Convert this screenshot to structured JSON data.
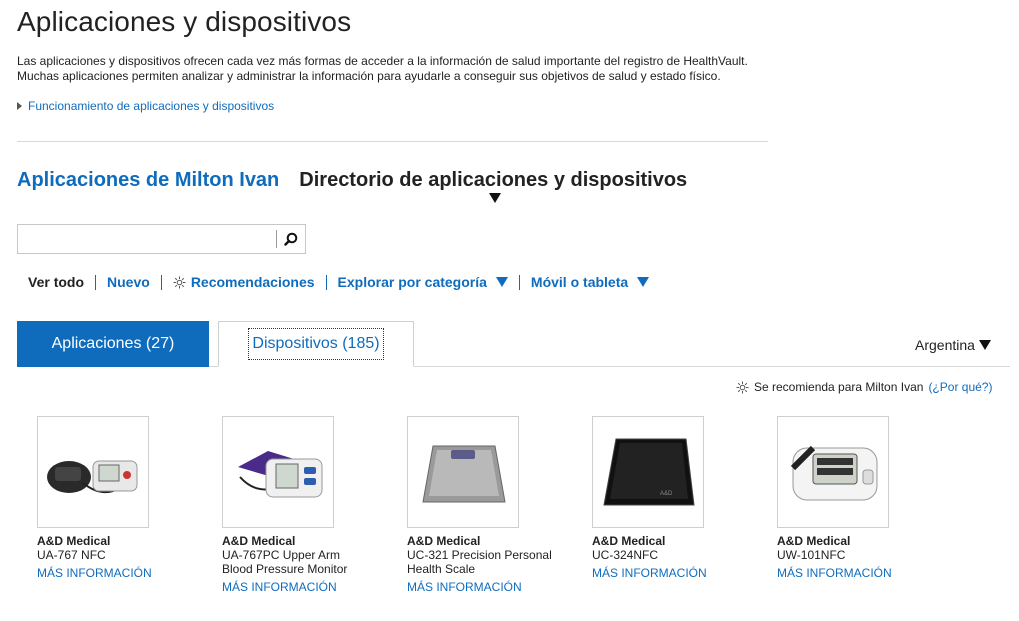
{
  "page": {
    "title": "Aplicaciones y dispositivos",
    "intro_line1": "Las aplicaciones y dispositivos ofrecen cada vez más formas de acceder a la información de salud importante del registro de HealthVault.",
    "intro_line2": "Muchas aplicaciones permiten analizar y administrar la información para ayudarle a conseguir sus objetivos de salud y estado físico.",
    "howto_link": "Funcionamiento de aplicaciones y dispositivos"
  },
  "section_tabs": {
    "my_apps": "Aplicaciones de Milton Ivan",
    "directory": "Directorio de aplicaciones y dispositivos"
  },
  "search": {
    "value": "",
    "placeholder": ""
  },
  "filters": {
    "all": "Ver todo",
    "new": "Nuevo",
    "recommended": "Recomendaciones",
    "browse": "Explorar por categoría",
    "mobile": "Móvil o tableta"
  },
  "tabs": {
    "apps": "Aplicaciones (27)",
    "devices": "Dispositivos (185)"
  },
  "country": "Argentina",
  "recommendation": {
    "text": "Se recomienda para Milton Ivan",
    "why": "(¿Por qué?)"
  },
  "devices": [
    {
      "maker": "A&D Medical",
      "model": "UA-767 NFC",
      "more": "MÁS INFORMACIÓN",
      "icon": "blood-pressure-monitors-image"
    },
    {
      "maker": "A&D Medical",
      "model": "UA-767PC Upper Arm Blood Pressure Monitor",
      "more": "MÁS INFORMACIÓN",
      "icon": "upper-arm-monitor-image"
    },
    {
      "maker": "A&D Medical",
      "model": "UC-321 Precision Personal Health Scale",
      "more": "MÁS INFORMACIÓN",
      "icon": "silver-scale-image"
    },
    {
      "maker": "A&D Medical",
      "model": "UC-324NFC",
      "more": "MÁS INFORMACIÓN",
      "icon": "black-scale-image"
    },
    {
      "maker": "A&D Medical",
      "model": "UW-101NFC",
      "more": "MÁS INFORMACIÓN",
      "icon": "activity-monitor-image"
    }
  ],
  "colors": {
    "accent": "#0f6cbd",
    "text": "#222222",
    "border": "#d8d8d8"
  }
}
